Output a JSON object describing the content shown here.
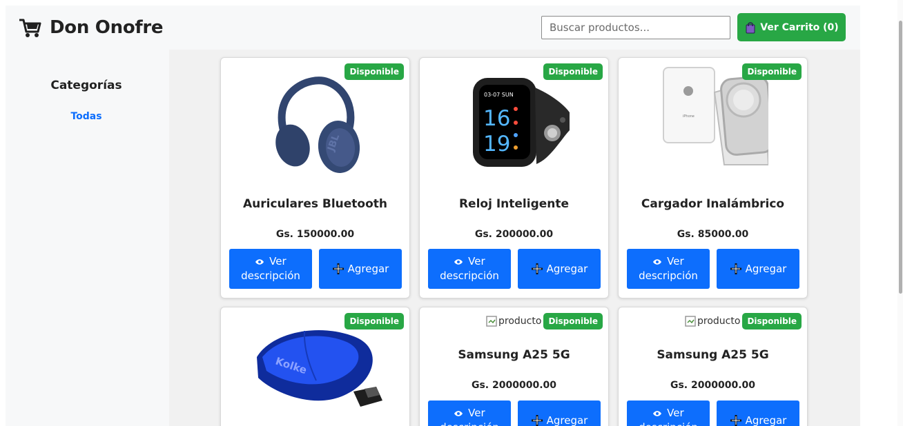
{
  "header": {
    "title": "Don Onofre",
    "search_placeholder": "Buscar productos...",
    "cart_label": "Ver Carrito (0)"
  },
  "sidebar": {
    "title": "Categorías",
    "items": [
      {
        "label": "Todas",
        "active": true
      }
    ]
  },
  "products": [
    {
      "name": "Auriculares Bluetooth",
      "price": "Gs. 150000.00",
      "badge": "Disponible",
      "image": "headphones"
    },
    {
      "name": "Reloj Inteligente",
      "price": "Gs. 200000.00",
      "badge": "Disponible",
      "image": "smartwatch",
      "watch_top": "03-07 SUN",
      "watch_hours": "16",
      "watch_minutes": "19"
    },
    {
      "name": "Cargador Inalámbrico",
      "price": "Gs. 85000.00",
      "badge": "Disponible",
      "image": "wireless-charger"
    },
    {
      "name": "",
      "price": "",
      "badge": "Disponible",
      "image": "mouse",
      "brand_text": "Kolke"
    },
    {
      "name": "Samsung A25 5G",
      "price": "Gs. 2000000.00",
      "badge": "Disponible",
      "image_alt": "producto"
    },
    {
      "name": "Samsung A25 5G",
      "price": "Gs. 2000000.00",
      "badge": "Disponible",
      "image_alt": "producto"
    }
  ],
  "buttons": {
    "description_line1": "Ver",
    "description_line2": "descripción",
    "add": "Agregar"
  },
  "colors": {
    "accent": "#0d6efd",
    "success": "#28a745",
    "sidebar_bg": "#f7f8f9",
    "main_bg": "#f1f1f1"
  }
}
